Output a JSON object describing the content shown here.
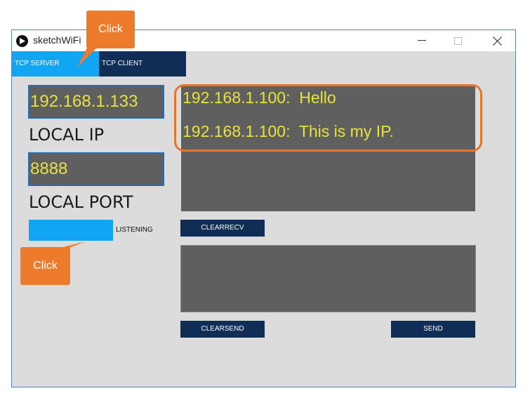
{
  "window": {
    "title": "sketchWiFi",
    "min_glyph": "—",
    "max_glyph": "☐",
    "close_glyph": "✕"
  },
  "tabs": [
    {
      "label": "TCP SERVER",
      "active": true
    },
    {
      "label": "TCP CLIENT",
      "active": false
    }
  ],
  "local": {
    "ip_value": "192.168.1.133",
    "ip_label": "LOCAL IP",
    "port_value": "8888",
    "port_label": "LOCAL PORT",
    "listen_label": "LISTENING"
  },
  "receive": {
    "messages": [
      "192.168.1.100:  Hello",
      "192.168.1.100:  This is my IP."
    ],
    "clear_label": "CLEARRECV"
  },
  "send": {
    "text": "",
    "clear_label": "CLEARSEND",
    "send_label": "SEND"
  },
  "annotations": {
    "callout_top": "Click",
    "callout_bottom": "Click"
  },
  "colors": {
    "accent": "#10a6f4",
    "dark_button": "#0f2d55",
    "field_bg": "#5f5f5f",
    "field_text": "#e6e33b",
    "annotation": "#ee7b2c"
  }
}
